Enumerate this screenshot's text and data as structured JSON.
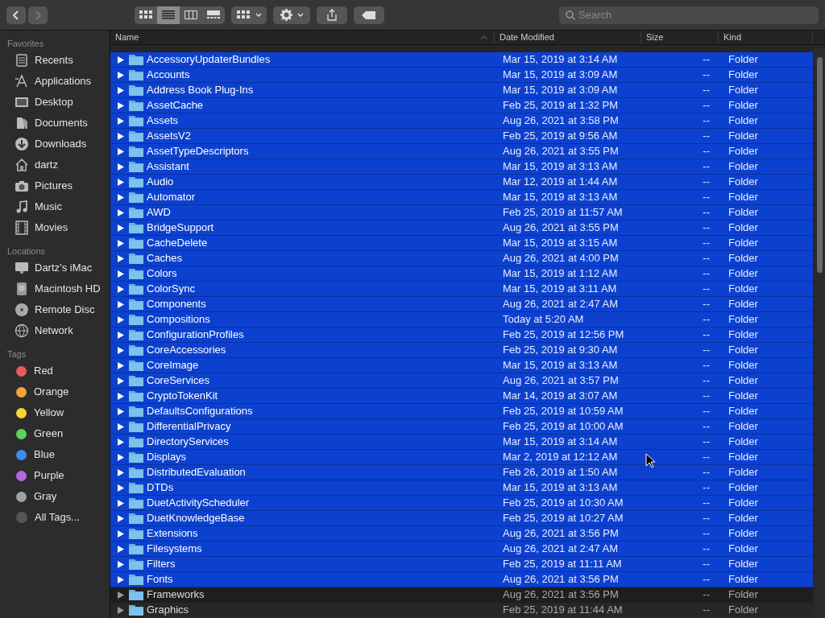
{
  "toolbar": {
    "nav": [
      {
        "kind": "back",
        "disabled": false
      },
      {
        "kind": "forward",
        "disabled": true
      }
    ],
    "views": [
      {
        "kind": "icons",
        "selected": false
      },
      {
        "kind": "list",
        "selected": true
      },
      {
        "kind": "columns",
        "selected": false
      },
      {
        "kind": "gallery",
        "selected": false
      }
    ],
    "search": {
      "placeholder": "Search"
    }
  },
  "sidebar": [
    {
      "title": "Favorites",
      "items": [
        {
          "label": "Recents"
        },
        {
          "label": "Applications"
        },
        {
          "label": "Desktop"
        },
        {
          "label": "Documents"
        },
        {
          "label": "Downloads"
        },
        {
          "label": "dartz"
        },
        {
          "label": "Pictures"
        },
        {
          "label": "Music"
        },
        {
          "label": "Movies"
        }
      ]
    },
    {
      "title": "Locations",
      "items": [
        {
          "label": "Dartz’s iMac"
        },
        {
          "label": "Macintosh HD"
        },
        {
          "label": "Remote Disc"
        },
        {
          "label": "Network"
        }
      ]
    },
    {
      "title": "Tags",
      "items": [
        {
          "label": "Red",
          "color": "#ec5a5e"
        },
        {
          "label": "Orange",
          "color": "#f2a33a"
        },
        {
          "label": "Yellow",
          "color": "#f5d531"
        },
        {
          "label": "Green",
          "color": "#5bd45a"
        },
        {
          "label": "Blue",
          "color": "#3c8cf0"
        },
        {
          "label": "Purple",
          "color": "#b866e0"
        },
        {
          "label": "Gray",
          "color": "#a0a0a0"
        },
        {
          "label": "All Tags..."
        }
      ]
    }
  ],
  "table": {
    "columns": [
      "Name",
      "Date Modified",
      "Size",
      "Kind"
    ],
    "rows": [
      {
        "name": "AccessoryUpdaterBundles",
        "date": "Mar 15, 2019 at 3:14 AM",
        "size": "--",
        "kind": "Folder",
        "selected": true
      },
      {
        "name": "Accounts",
        "date": "Mar 15, 2019 at 3:09 AM",
        "size": "--",
        "kind": "Folder",
        "selected": true
      },
      {
        "name": "Address Book Plug-Ins",
        "date": "Mar 15, 2019 at 3:09 AM",
        "size": "--",
        "kind": "Folder",
        "selected": true
      },
      {
        "name": "AssetCache",
        "date": "Feb 25, 2019 at 1:32 PM",
        "size": "--",
        "kind": "Folder",
        "selected": true
      },
      {
        "name": "Assets",
        "date": "Aug 26, 2021 at 3:58 PM",
        "size": "--",
        "kind": "Folder",
        "selected": true
      },
      {
        "name": "AssetsV2",
        "date": "Feb 25, 2019 at 9:56 AM",
        "size": "--",
        "kind": "Folder",
        "selected": true
      },
      {
        "name": "AssetTypeDescriptors",
        "date": "Aug 26, 2021 at 3:55 PM",
        "size": "--",
        "kind": "Folder",
        "selected": true
      },
      {
        "name": "Assistant",
        "date": "Mar 15, 2019 at 3:13 AM",
        "size": "--",
        "kind": "Folder",
        "selected": true
      },
      {
        "name": "Audio",
        "date": "Mar 12, 2019 at 1:44 AM",
        "size": "--",
        "kind": "Folder",
        "selected": true
      },
      {
        "name": "Automator",
        "date": "Mar 15, 2019 at 3:13 AM",
        "size": "--",
        "kind": "Folder",
        "selected": true
      },
      {
        "name": "AWD",
        "date": "Feb 25, 2019 at 11:57 AM",
        "size": "--",
        "kind": "Folder",
        "selected": true
      },
      {
        "name": "BridgeSupport",
        "date": "Aug 26, 2021 at 3:55 PM",
        "size": "--",
        "kind": "Folder",
        "selected": true
      },
      {
        "name": "CacheDelete",
        "date": "Mar 15, 2019 at 3:15 AM",
        "size": "--",
        "kind": "Folder",
        "selected": true
      },
      {
        "name": "Caches",
        "date": "Aug 26, 2021 at 4:00 PM",
        "size": "--",
        "kind": "Folder",
        "selected": true
      },
      {
        "name": "Colors",
        "date": "Mar 15, 2019 at 1:12 AM",
        "size": "--",
        "kind": "Folder",
        "selected": true
      },
      {
        "name": "ColorSync",
        "date": "Mar 15, 2019 at 3:11 AM",
        "size": "--",
        "kind": "Folder",
        "selected": true
      },
      {
        "name": "Components",
        "date": "Aug 26, 2021 at 2:47 AM",
        "size": "--",
        "kind": "Folder",
        "selected": true
      },
      {
        "name": "Compositions",
        "date": "Today at 5:20 AM",
        "size": "--",
        "kind": "Folder",
        "selected": true
      },
      {
        "name": "ConfigurationProfiles",
        "date": "Feb 25, 2019 at 12:56 PM",
        "size": "--",
        "kind": "Folder",
        "selected": true
      },
      {
        "name": "CoreAccessories",
        "date": "Feb 25, 2019 at 9:30 AM",
        "size": "--",
        "kind": "Folder",
        "selected": true
      },
      {
        "name": "CoreImage",
        "date": "Mar 15, 2019 at 3:13 AM",
        "size": "--",
        "kind": "Folder",
        "selected": true
      },
      {
        "name": "CoreServices",
        "date": "Aug 26, 2021 at 3:57 PM",
        "size": "--",
        "kind": "Folder",
        "selected": true
      },
      {
        "name": "CryptoTokenKit",
        "date": "Mar 14, 2019 at 3:07 AM",
        "size": "--",
        "kind": "Folder",
        "selected": true
      },
      {
        "name": "DefaultsConfigurations",
        "date": "Feb 25, 2019 at 10:59 AM",
        "size": "--",
        "kind": "Folder",
        "selected": true
      },
      {
        "name": "DifferentialPrivacy",
        "date": "Feb 25, 2019 at 10:00 AM",
        "size": "--",
        "kind": "Folder",
        "selected": true
      },
      {
        "name": "DirectoryServices",
        "date": "Mar 15, 2019 at 3:14 AM",
        "size": "--",
        "kind": "Folder",
        "selected": true
      },
      {
        "name": "Displays",
        "date": "Mar 2, 2019 at 12:12 AM",
        "size": "--",
        "kind": "Folder",
        "selected": true
      },
      {
        "name": "DistributedEvaluation",
        "date": "Feb 26, 2019 at 1:50 AM",
        "size": "--",
        "kind": "Folder",
        "selected": true
      },
      {
        "name": "DTDs",
        "date": "Mar 15, 2019 at 3:13 AM",
        "size": "--",
        "kind": "Folder",
        "selected": true
      },
      {
        "name": "DuetActivityScheduler",
        "date": "Feb 25, 2019 at 10:30 AM",
        "size": "--",
        "kind": "Folder",
        "selected": true
      },
      {
        "name": "DuetKnowledgeBase",
        "date": "Feb 25, 2019 at 10:27 AM",
        "size": "--",
        "kind": "Folder",
        "selected": true
      },
      {
        "name": "Extensions",
        "date": "Aug 26, 2021 at 3:56 PM",
        "size": "--",
        "kind": "Folder",
        "selected": true
      },
      {
        "name": "Filesystems",
        "date": "Aug 26, 2021 at 2:47 AM",
        "size": "--",
        "kind": "Folder",
        "selected": true
      },
      {
        "name": "Filters",
        "date": "Feb 25, 2019 at 11:11 AM",
        "size": "--",
        "kind": "Folder",
        "selected": true
      },
      {
        "name": "Fonts",
        "date": "Aug 26, 2021 at 3:56 PM",
        "size": "--",
        "kind": "Folder",
        "selected": true
      },
      {
        "name": "Frameworks",
        "date": "Aug 26, 2021 at 3:56 PM",
        "size": "--",
        "kind": "Folder",
        "selected": false
      },
      {
        "name": "Graphics",
        "date": "Feb 25, 2019 at 11:44 AM",
        "size": "--",
        "kind": "Folder",
        "selected": false
      }
    ]
  }
}
